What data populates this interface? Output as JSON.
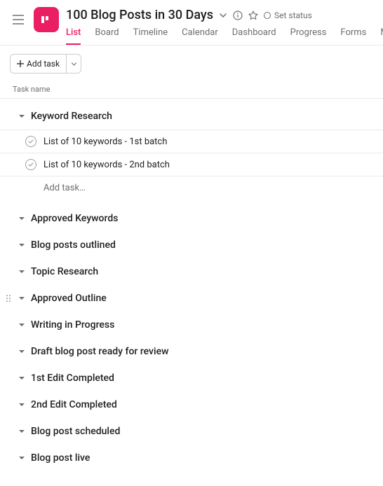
{
  "header": {
    "project_title": "100 Blog Posts in 30 Days",
    "set_status_label": "Set status"
  },
  "tabs": [
    {
      "label": "List",
      "active": true
    },
    {
      "label": "Board"
    },
    {
      "label": "Timeline"
    },
    {
      "label": "Calendar"
    },
    {
      "label": "Dashboard"
    },
    {
      "label": "Progress"
    },
    {
      "label": "Forms"
    },
    {
      "label": "More…"
    }
  ],
  "toolbar": {
    "add_task_label": "Add task"
  },
  "column_header": "Task name",
  "add_task_inline": "Add task…",
  "sections": [
    {
      "title": "Keyword Research",
      "expanded": true,
      "tasks": [
        {
          "name": "List of 10 keywords - 1st batch"
        },
        {
          "name": "List of 10 keywords - 2nd batch"
        }
      ]
    },
    {
      "title": "Approved Keywords",
      "expanded": false
    },
    {
      "title": "Blog posts outlined",
      "expanded": false
    },
    {
      "title": "Topic Research",
      "expanded": false
    },
    {
      "title": "Approved Outline",
      "expanded": false,
      "show_drag": true
    },
    {
      "title": "Writing in Progress",
      "expanded": false
    },
    {
      "title": "Draft blog post ready for review",
      "expanded": false
    },
    {
      "title": "1st Edit Completed",
      "expanded": false
    },
    {
      "title": "2nd Edit Completed",
      "expanded": false
    },
    {
      "title": "Blog post scheduled",
      "expanded": false
    },
    {
      "title": "Blog post live",
      "expanded": false
    }
  ]
}
